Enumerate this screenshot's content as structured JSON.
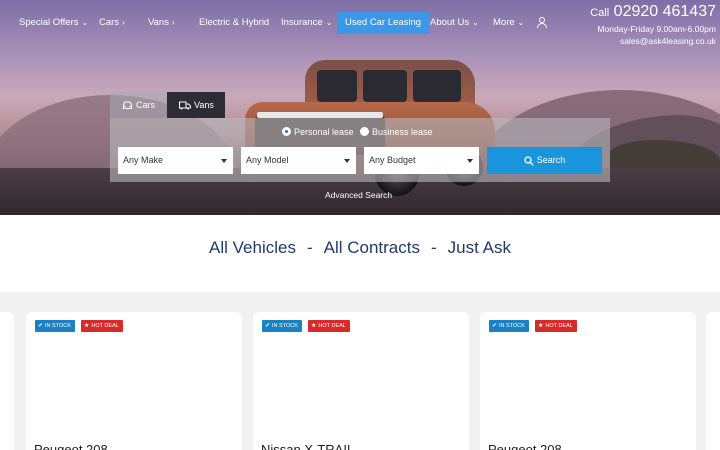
{
  "nav": {
    "items": [
      {
        "label": "Special Offers",
        "chev": "⌄"
      },
      {
        "label": "Cars",
        "chev": "›"
      },
      {
        "label": "Vans",
        "chev": "›"
      },
      {
        "label": "Electric & Hybrid",
        "chev": ""
      },
      {
        "label": "Insurance",
        "chev": "⌄"
      },
      {
        "label": "Used Car Leasing",
        "chev": ""
      },
      {
        "label": "About Us",
        "chev": "⌄"
      },
      {
        "label": "More",
        "chev": "⌄"
      }
    ],
    "account_icon": "user-icon",
    "active_color": "#3c97e6"
  },
  "contact": {
    "call_label": "Call",
    "phone": "02920 461437",
    "hours": "Monday-Friday 9.00am-6.00pm",
    "email": "sales@ask4leasing.co.uk"
  },
  "search": {
    "tabs": [
      {
        "label": "Cars",
        "icon": "car-icon"
      },
      {
        "label": "Vans",
        "icon": "van-icon"
      }
    ],
    "lease_types": [
      {
        "label": "Personal lease",
        "selected": true
      },
      {
        "label": "Business lease",
        "selected": false
      }
    ],
    "make": "Any Make",
    "model": "Any Model",
    "budget": "Any Budget",
    "button": "Search",
    "advanced": "Advanced Search",
    "button_color": "#1a95dd"
  },
  "tagline": {
    "part1": "All Vehicles",
    "sep": "-",
    "part2": "All Contracts",
    "part3": "Just Ask",
    "color": "#213a68"
  },
  "cards": [
    {
      "stock": "IN STOCK",
      "deal": "HOT DEAL",
      "title": "Peugeot 208"
    },
    {
      "stock": "IN STOCK",
      "deal": "HOT DEAL",
      "title": "Nissan X-TRAIL"
    },
    {
      "stock": "IN STOCK",
      "deal": "HOT DEAL",
      "title": "Peugeot 208"
    }
  ]
}
